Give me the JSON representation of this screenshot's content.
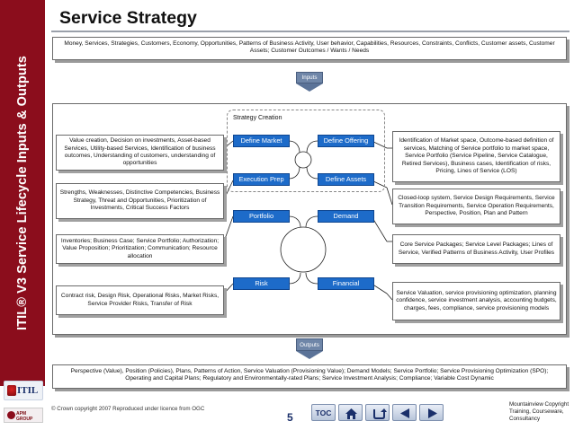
{
  "sidebar": {
    "title": "ITIL® V3 Service Lifecycle Inputs & Outputs"
  },
  "logos": {
    "itil": "ITIL",
    "apm": "APM GROUP"
  },
  "header": {
    "title": "Service Strategy"
  },
  "inputs": {
    "text": "Money, Services, Strategies, Customers, Economy, Opportunities, Patterns of Business Activity, User behavior, Capabilities, Resources, Constraints, Conflicts, Customer assets, Customer Assets; Customer Outcomes / Wants / Needs",
    "arrow_label": "Inputs"
  },
  "strategy_creation": {
    "label": "Strategy Creation",
    "nodes": [
      "Define Market",
      "Define Offering",
      "Execution Prep",
      "Define Assets"
    ]
  },
  "lower_nodes": [
    "Portfolio",
    "Demand",
    "Risk",
    "Financial"
  ],
  "left_items": [
    "Value creation, Decision on investments, Asset-based Services, Utility-based Services, Identification of business outcomes, Understanding of customers, understanding of opportunities",
    "Strengths, Weaknesses, Distinctive Competencies, Business Strategy, Threat and Opportunities, Prioritization of Investments, Critical Success Factors",
    "Inventories; Business Case; Service Portfolio; Authorization; Value Proposition; Prioritization; Communication; Resource allocation",
    "Contract risk, Design Risk, Operational Risks, Market Risks, Service Provider Risks, Transfer of Risk"
  ],
  "right_items": [
    "Identification of Market space, Outcome-based definition of services, Matching of Service portfolio to market space, Service Portfolio (Service Pipeline, Service Catalogue, Retired Services), Business cases, Identification of risks, Pricing, Lines of Service (LOS)",
    "Closed-loop system, Service Design Requirements, Service Transition Requirements, Service Operation Requirements, Perspective, Position, Plan and Pattern",
    "Core Service Packages; Service Level Packages; Lines of Service, Verified Patterns of Business Activity, User Profiles",
    "Service Valuation, service provisioning optimization, planning confidence, service investment analysis, accounting budgets, charges, fees, compliance, service provisioning models"
  ],
  "outputs": {
    "arrow_label": "Outputs",
    "text": "Perspective (Value), Position (Policies), Plans, Patterns of Action, Service Valuation (Provisioning Value); Demand Models; Service Portfolio; Service Provisioning Optimization (SPO); Operating and Capital Plans; Regulatory and Environmentally-rated Plans; Service Investment Analysis; Compliance; Variable Cost Dynamic"
  },
  "footer": {
    "copyright": "© Crown copyright 2007 Reproduced under licence from OGC",
    "page_number": "5",
    "toc_label": "TOC",
    "right_text": "Mountainview Copyright Training, Courseware, Consultancy"
  },
  "colors": {
    "sidebar": "#8b0d1c",
    "node_blue": "#1d6bc9",
    "arrow": "#6f86a8"
  }
}
